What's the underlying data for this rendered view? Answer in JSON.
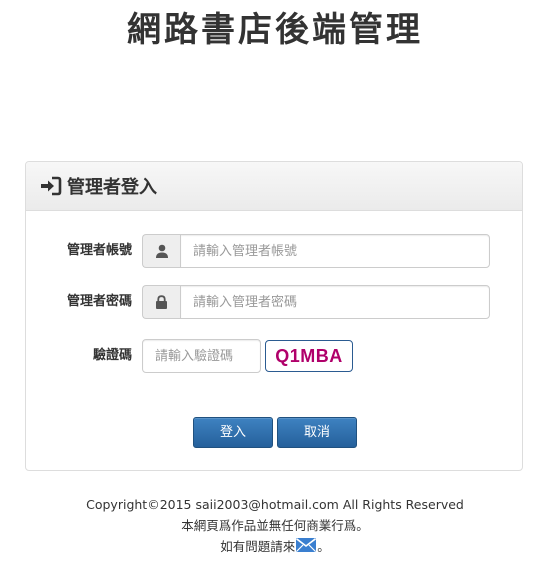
{
  "header": {
    "title": "網路書店後端管理"
  },
  "login_panel": {
    "title": "管理者登入",
    "title_icon": "sign-in-icon",
    "account": {
      "label": "管理者帳號",
      "icon": "user-icon",
      "placeholder": "請輸入管理者帳號",
      "value": ""
    },
    "password": {
      "label": "管理者密碼",
      "icon": "lock-icon",
      "placeholder": "請輸入管理者密碼",
      "value": ""
    },
    "captcha": {
      "label": "驗證碼",
      "placeholder": "請輸入驗證碼",
      "value": "",
      "image_text": "Q1MBA"
    },
    "buttons": {
      "login": "登入",
      "cancel": "取消"
    }
  },
  "footer": {
    "copyright": "Copyright©2015 saii2003@hotmail.com All Rights Reserved",
    "disclaimer": "本網頁爲作品並無任何商業行爲。",
    "contact_prefix": "如有問題請來",
    "contact_suffix": "。",
    "contact_icon": "mail-icon"
  },
  "colors": {
    "button_primary": "#2e6da4",
    "captcha_text": "#b0006a",
    "captcha_border": "#2b5b91",
    "mail_icon": "#3a7fd0"
  }
}
